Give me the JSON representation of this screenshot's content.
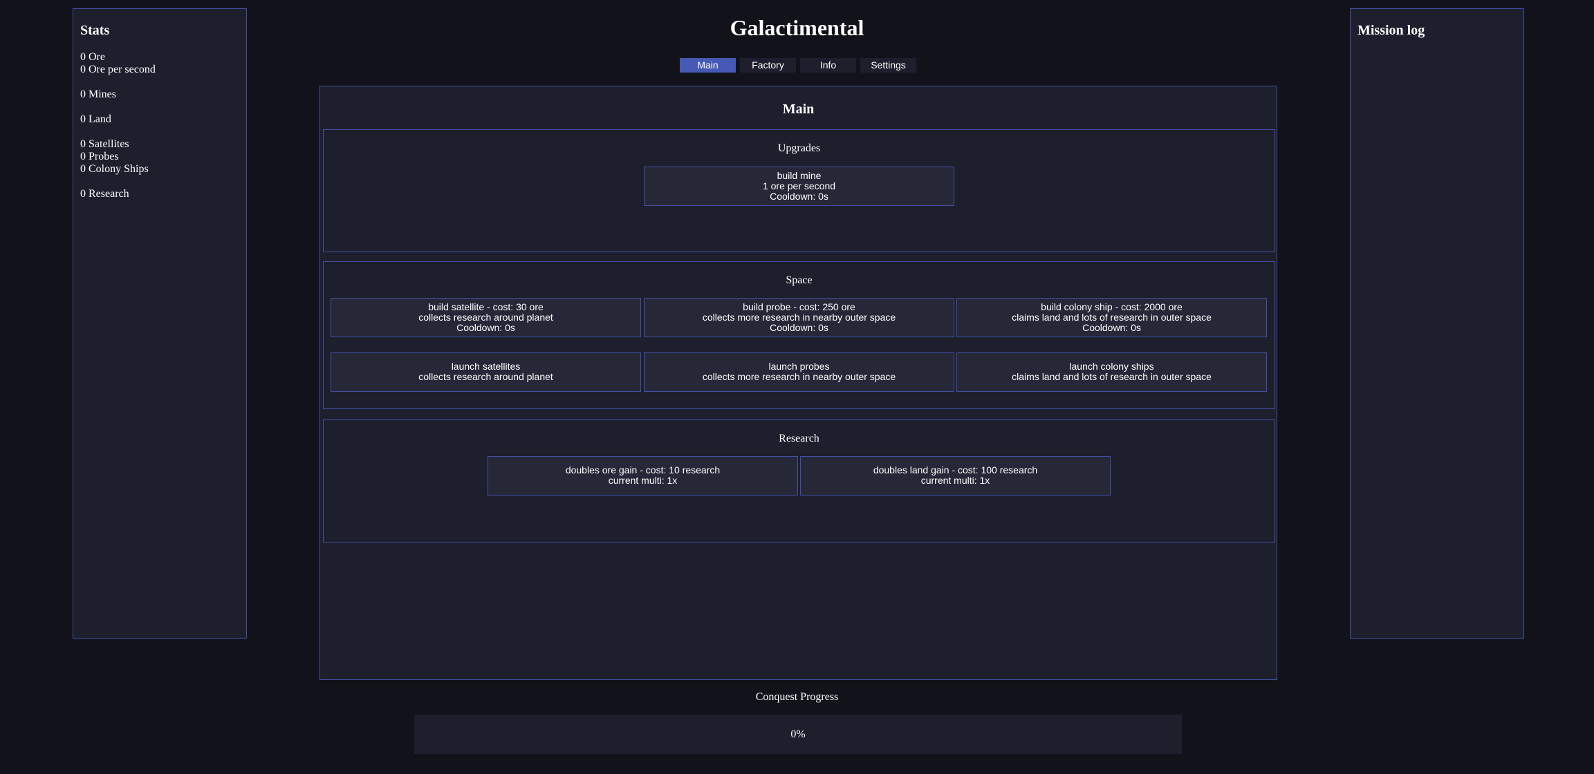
{
  "app": {
    "title": "Galactimental"
  },
  "tabs": [
    {
      "label": "Main",
      "active": true
    },
    {
      "label": "Factory",
      "active": false
    },
    {
      "label": "Info",
      "active": false
    },
    {
      "label": "Settings",
      "active": false
    }
  ],
  "stats": {
    "title": "Stats",
    "ore": "0 Ore",
    "ore_per_second": "0 Ore per second",
    "mines": "0 Mines",
    "land": "0 Land",
    "satellites": "0 Satellites",
    "probes": "0 Probes",
    "colony_ships": "0 Colony Ships",
    "research": "0 Research"
  },
  "mission_log": {
    "title": "Mission log"
  },
  "main": {
    "title": "Main",
    "upgrades": {
      "title": "Upgrades",
      "build_mine": {
        "line1": "build mine",
        "line2": "1 ore per second",
        "line3": "Cooldown: 0s"
      }
    },
    "space": {
      "title": "Space",
      "build_satellite": {
        "line1": "build satellite - cost: 30 ore",
        "line2": "collects research around planet",
        "line3": "Cooldown: 0s"
      },
      "build_probe": {
        "line1": "build probe - cost: 250 ore",
        "line2": "collects more research in nearby outer space",
        "line3": "Cooldown: 0s"
      },
      "build_colony_ship": {
        "line1": "build colony ship - cost: 2000 ore",
        "line2": "claims land and lots of research in outer space",
        "line3": "Cooldown: 0s"
      },
      "launch_satellites": {
        "line1": "launch satellites",
        "line2": "collects research around planet"
      },
      "launch_probes": {
        "line1": "launch probes",
        "line2": "collects more research in nearby outer space"
      },
      "launch_colony_ships": {
        "line1": "launch colony ships",
        "line2": "claims land and lots of research in outer space"
      }
    },
    "research": {
      "title": "Research",
      "double_ore": {
        "line1": "doubles ore gain - cost: 10 research",
        "line2": "current multi: 1x"
      },
      "double_land": {
        "line1": "doubles land gain - cost: 100 research",
        "line2": "current multi: 1x"
      }
    }
  },
  "conquest": {
    "label": "Conquest Progress",
    "value_text": "0%",
    "fraction": 0
  },
  "colors": {
    "background": "#12131a",
    "panel": "#1e1f2d",
    "border": "#4150a6",
    "accent": "#4659b5"
  }
}
